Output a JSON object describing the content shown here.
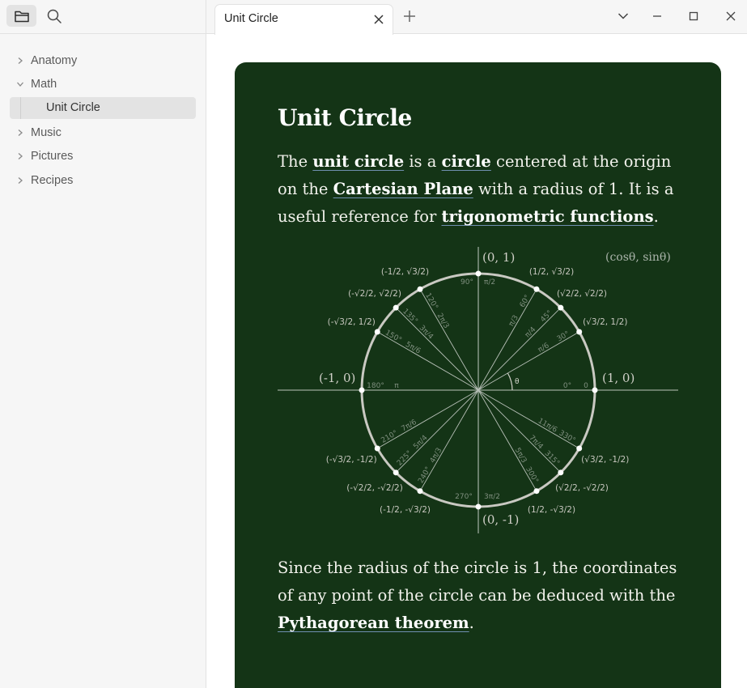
{
  "sidebar": {
    "icons": {
      "files": "folder-icon",
      "search": "search-icon"
    },
    "items": [
      {
        "label": "Anatomy",
        "expanded": false
      },
      {
        "label": "Math",
        "expanded": true,
        "children": [
          {
            "label": "Unit Circle",
            "selected": true
          }
        ]
      },
      {
        "label": "Music",
        "expanded": false
      },
      {
        "label": "Pictures",
        "expanded": false
      },
      {
        "label": "Recipes",
        "expanded": false
      }
    ]
  },
  "tabs": [
    {
      "title": "Unit Circle",
      "active": true
    }
  ],
  "window_controls": [
    "chevron-down-icon",
    "minimize-icon",
    "maximize-icon",
    "close-icon"
  ],
  "note": {
    "title": "Unit Circle",
    "para1": {
      "t1": "The ",
      "l1": "unit circle",
      "t2": " is a ",
      "l2": "circle",
      "t3": " centered at the origin on the ",
      "l3": "Cartesian Plane",
      "t4": " with a radius of 1. It is a useful reference for ",
      "l4": "trigonometric functions",
      "t5": "."
    },
    "para2": {
      "t1": "Since the radius of the circle is 1, the coordinates of any point of the circle can be deduced with the ",
      "l1": "Pythagorean theorem",
      "t2": "."
    },
    "diagram": {
      "axis_labels": {
        "top": "(0, 1)",
        "bottom": "(0, -1)",
        "left": "(-1, 0)",
        "right": "(1, 0)",
        "legend": "(cosθ, sinθ)",
        "theta": "θ"
      },
      "angles": [
        {
          "deg": "0°",
          "rad": "0",
          "cos": "1",
          "sin": "0"
        },
        {
          "deg": "30°",
          "rad": "π/6",
          "cos": "√3/2",
          "sin": "1/2"
        },
        {
          "deg": "45°",
          "rad": "π/4",
          "cos": "√2/2",
          "sin": "√2/2"
        },
        {
          "deg": "60°",
          "rad": "π/3",
          "cos": "1/2",
          "sin": "√3/2"
        },
        {
          "deg": "90°",
          "rad": "π/2",
          "cos": "0",
          "sin": "1"
        },
        {
          "deg": "120°",
          "rad": "2π/3",
          "cos": "-1/2",
          "sin": "√3/2"
        },
        {
          "deg": "135°",
          "rad": "3π/4",
          "cos": "-√2/2",
          "sin": "√2/2"
        },
        {
          "deg": "150°",
          "rad": "5π/6",
          "cos": "-√3/2",
          "sin": "1/2"
        },
        {
          "deg": "180°",
          "rad": "π",
          "cos": "-1",
          "sin": "0"
        },
        {
          "deg": "210°",
          "rad": "7π/6",
          "cos": "-√3/2",
          "sin": "-1/2"
        },
        {
          "deg": "225°",
          "rad": "5π/4",
          "cos": "-√2/2",
          "sin": "-√2/2"
        },
        {
          "deg": "240°",
          "rad": "4π/3",
          "cos": "-1/2",
          "sin": "-√3/2"
        },
        {
          "deg": "270°",
          "rad": "3π/2",
          "cos": "0",
          "sin": "-1"
        },
        {
          "deg": "300°",
          "rad": "5π/3",
          "cos": "1/2",
          "sin": "-√3/2"
        },
        {
          "deg": "315°",
          "rad": "7π/4",
          "cos": "√2/2",
          "sin": "-√2/2"
        },
        {
          "deg": "330°",
          "rad": "11π/6",
          "cos": "√3/2",
          "sin": "-1/2"
        }
      ]
    }
  },
  "colors": {
    "board": "#143416",
    "sidebar": "#f6f6f6",
    "chalk": "#f2f2ec"
  }
}
